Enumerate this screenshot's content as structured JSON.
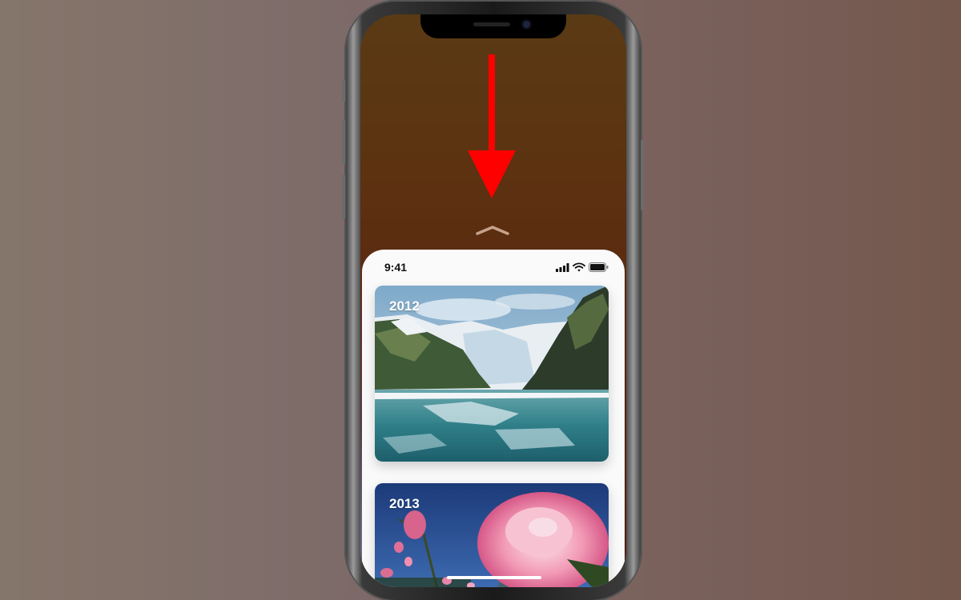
{
  "status_bar": {
    "time": "9:41"
  },
  "cards": [
    {
      "year": "2012",
      "scene": "glacier-bay"
    },
    {
      "year": "2013",
      "scene": "dahlia-flower"
    }
  ],
  "overlay": {
    "arrow_color": "#ff0000",
    "direction": "down"
  },
  "colors": {
    "sheet_bg": "#fafafa",
    "arrow": "#ff0000"
  }
}
